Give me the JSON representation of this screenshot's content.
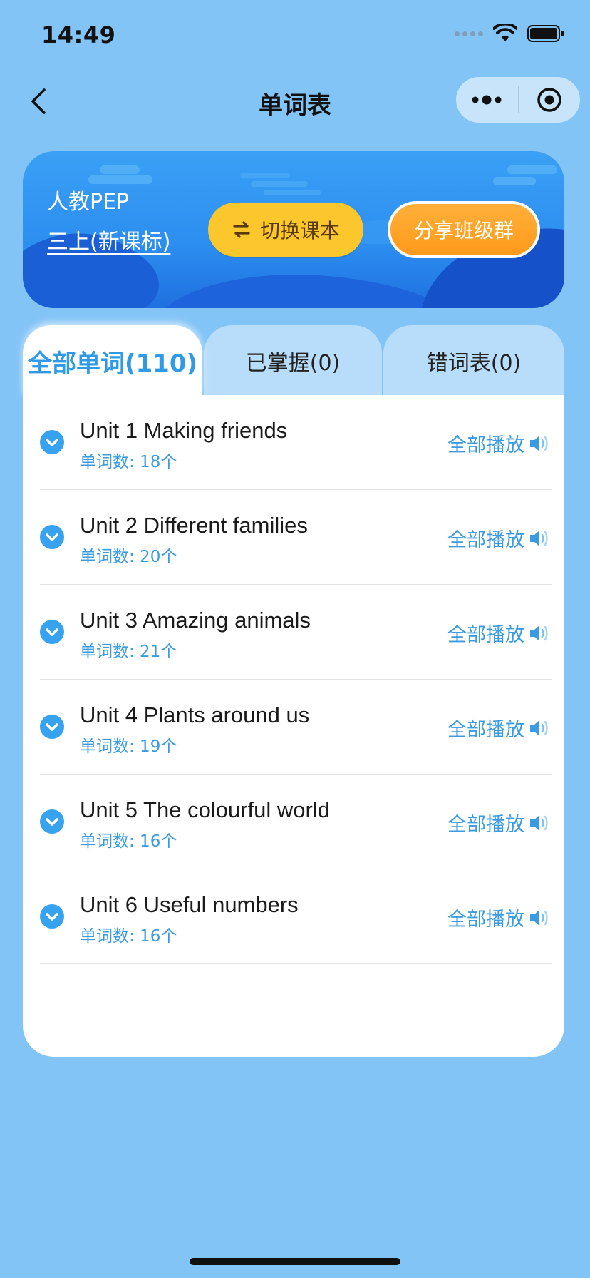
{
  "status_bar": {
    "time": "14:49"
  },
  "nav": {
    "title": "单词表"
  },
  "banner": {
    "book_line1": "人教PEP",
    "book_line2": "三上(新课标)",
    "switch_label": "切换课本",
    "share_label": "分享班级群"
  },
  "tabs": [
    {
      "label": "全部单词(110)",
      "active": true
    },
    {
      "label": "已掌握(0)",
      "active": false
    },
    {
      "label": "错词表(0)",
      "active": false
    }
  ],
  "units": [
    {
      "title": "Unit 1 Making friends",
      "count": "单词数: 18个",
      "play": "全部播放"
    },
    {
      "title": "Unit 2 Different families",
      "count": "单词数: 20个",
      "play": "全部播放"
    },
    {
      "title": "Unit 3 Amazing animals",
      "count": "单词数: 21个",
      "play": "全部播放"
    },
    {
      "title": "Unit 4 Plants around us",
      "count": "单词数: 19个",
      "play": "全部播放"
    },
    {
      "title": "Unit 5 The colourful world",
      "count": "单词数: 16个",
      "play": "全部播放"
    },
    {
      "title": "Unit 6 Useful numbers",
      "count": "单词数: 16个",
      "play": "全部播放"
    }
  ],
  "colors": {
    "background": "#83c4f7",
    "accent": "#37a2f0",
    "switch_button": "#fcc62d",
    "share_button": "#ff9a1a"
  },
  "icons": [
    "back-chevron-icon",
    "more-dots-icon",
    "target-icon",
    "switch-arrows-icon",
    "chevron-down-icon",
    "speaker-icon",
    "wifi-icon",
    "battery-icon"
  ]
}
